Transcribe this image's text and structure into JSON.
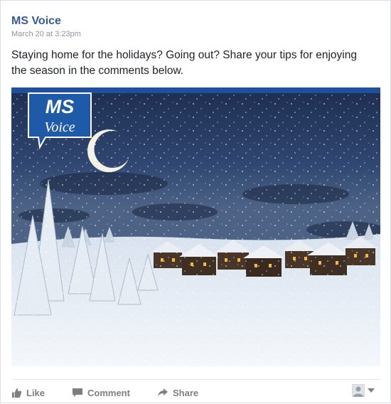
{
  "post": {
    "page_name": "MS Voice",
    "timestamp": "March 20 at 3:23pm",
    "text": "Staying home for the holidays? Going out? Share your tips for enjoying the season in the comments below."
  },
  "image": {
    "logo_line1": "MS",
    "logo_line2": "Voice"
  },
  "actions": {
    "like_label": "Like",
    "comment_label": "Comment",
    "share_label": "Share"
  },
  "colors": {
    "link": "#365899",
    "brand": "#1f4f9f",
    "action": "#7f7f7f"
  }
}
